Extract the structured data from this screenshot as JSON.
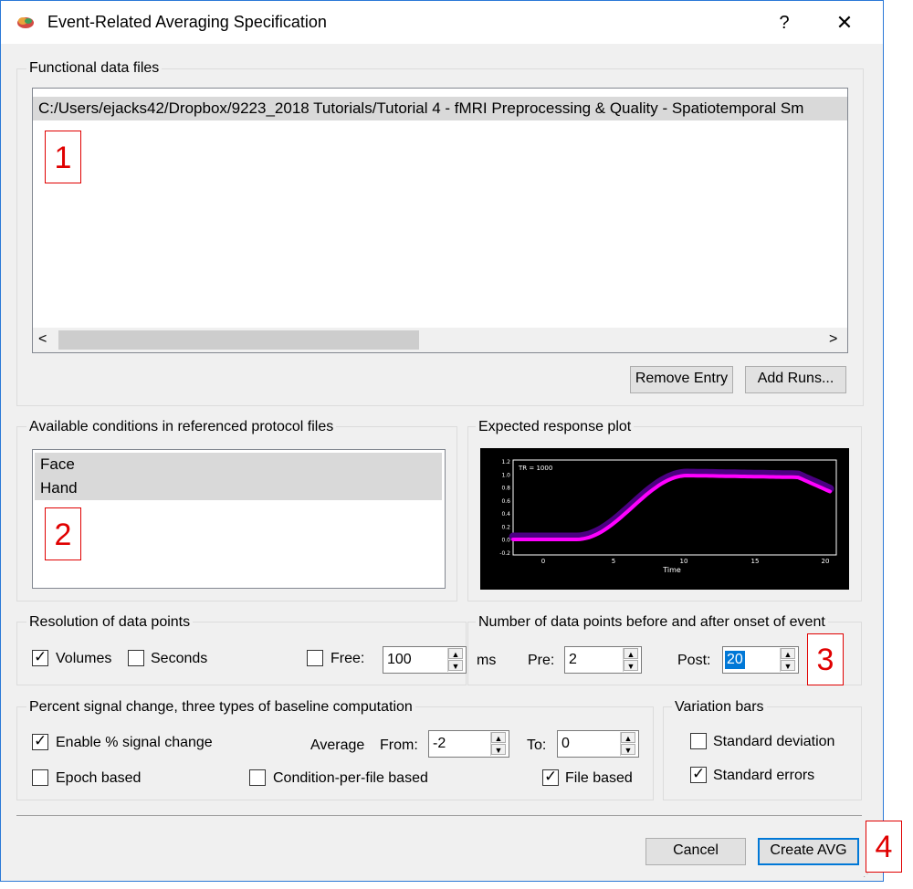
{
  "window": {
    "title": "Event-Related Averaging Specification",
    "help": "?",
    "close": "✕"
  },
  "functional": {
    "group_title": "Functional data files",
    "files": [
      "C:/Users/ejacks42/Dropbox/9223_2018 Tutorials/Tutorial 4 - fMRI Preprocessing & Quality - Spatiotemporal Sm"
    ],
    "remove_label": "Remove Entry",
    "add_label": "Add Runs...",
    "scroll_left": "<",
    "scroll_right": ">"
  },
  "conditions": {
    "group_title": "Available conditions in referenced protocol files",
    "items": [
      "Face",
      "Hand"
    ]
  },
  "plot": {
    "group_title": "Expected response plot",
    "tr_label": "TR = 1000",
    "xlabel": "Time",
    "x_ticks": [
      "0",
      "5",
      "10",
      "15",
      "20"
    ],
    "y_ticks": [
      "1.2",
      "1.0",
      "0.8",
      "0.6",
      "0.4",
      "0.2",
      "0.0",
      "-0.2"
    ],
    "line_color": "#ff00ff",
    "error_color": "#4b0082"
  },
  "resolution": {
    "group_title": "Resolution of data points",
    "volumes_label": "Volumes",
    "volumes_checked": true,
    "seconds_label": "Seconds",
    "seconds_checked": false,
    "free_label": "Free:",
    "free_checked": false,
    "free_value": "100",
    "unit": "ms"
  },
  "points": {
    "group_title": "Number of data points before and after onset of event",
    "pre_label": "Pre:",
    "pre_value": "2",
    "post_label": "Post:",
    "post_value": "20"
  },
  "psc": {
    "group_title": "Percent signal change, three types of baseline computation",
    "enable_label": "Enable % signal change",
    "enable_checked": true,
    "average_label": "Average",
    "from_label": "From:",
    "from_value": "-2",
    "to_label": "To:",
    "to_value": "0",
    "epoch_label": "Epoch based",
    "epoch_checked": false,
    "cond_label": "Condition-per-file based",
    "cond_checked": false,
    "file_label": "File based",
    "file_checked": true
  },
  "variation": {
    "group_title": "Variation bars",
    "sd_label": "Standard deviation",
    "sd_checked": false,
    "se_label": "Standard errors",
    "se_checked": true
  },
  "footer": {
    "cancel_label": "Cancel",
    "create_label": "Create AVG"
  },
  "annotations": [
    "1",
    "2",
    "3",
    "4"
  ],
  "colors": {
    "accent": "#0078d7",
    "annotation": "#e00000"
  }
}
